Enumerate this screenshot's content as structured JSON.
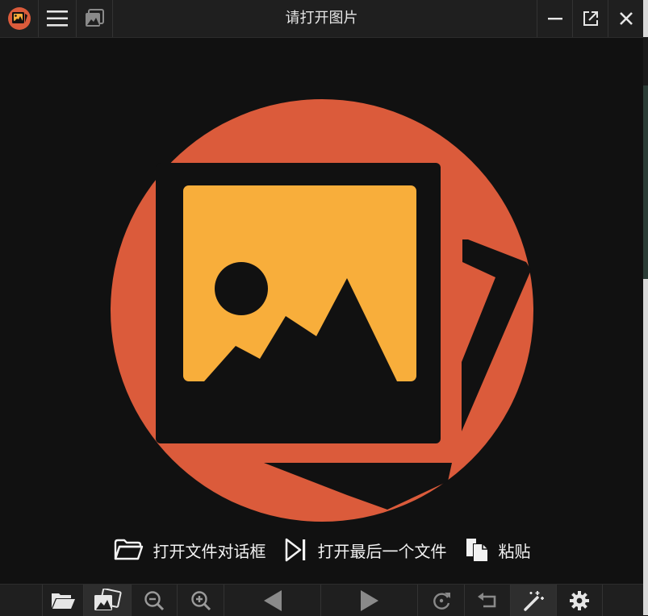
{
  "window": {
    "title": "请打开图片"
  },
  "actions": {
    "open_dialog": "打开文件对话框",
    "open_last": "打开最后一个文件",
    "paste": "粘贴"
  },
  "colors": {
    "background": "#111111",
    "bar": "#1f1f1f",
    "logo_orange": "#db5b3b",
    "logo_yellow": "#f8ae3b"
  },
  "icons": {
    "titlebar": [
      "app-logo-icon",
      "menu-icon",
      "gallery-icon",
      "minimize-icon",
      "popout-icon",
      "close-icon"
    ],
    "toolbar": [
      "folder-open-icon",
      "gallery-icon",
      "zoom-out-icon",
      "zoom-in-icon",
      "previous-icon",
      "next-icon",
      "rotate-icon",
      "undo-icon",
      "magic-wand-icon",
      "settings-icon"
    ]
  }
}
